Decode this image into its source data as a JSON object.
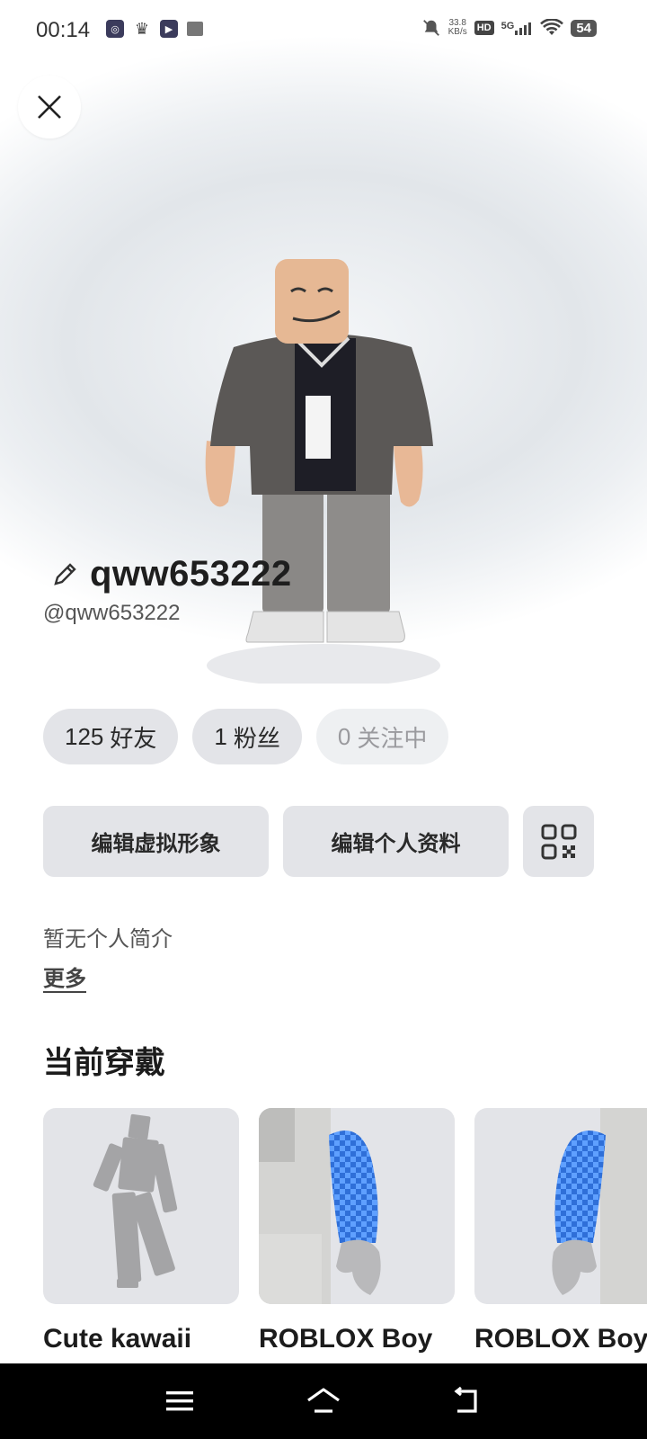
{
  "status_bar": {
    "time": "00:14",
    "net_speed_value": "33.8",
    "net_speed_unit": "KB/s",
    "hd_label": "HD",
    "signal_label": "5G",
    "battery": "54",
    "left_icons": [
      "badge-app-icon",
      "crown-icon",
      "play-app-icon",
      "book-icon"
    ]
  },
  "profile": {
    "display_name": "qww653222",
    "username": "@qww653222"
  },
  "stats": {
    "friends_count": "125",
    "friends_label": "好友",
    "followers_count": "1",
    "followers_label": "粉丝",
    "following_count": "0",
    "following_label": "关注中"
  },
  "actions": {
    "edit_avatar": "编辑虚拟形象",
    "edit_profile": "编辑个人资料"
  },
  "bio": {
    "text": "暂无个人简介",
    "more": "更多"
  },
  "wearing": {
    "title": "当前穿戴",
    "items": [
      {
        "name": "Cute kawaii"
      },
      {
        "name": "ROBLOX Boy"
      },
      {
        "name": "ROBLOX Boy"
      }
    ]
  },
  "colors": {
    "pill_bg": "#e3e4e8",
    "nav_bg": "#000000",
    "sleeve_blue": "#3a7be0"
  }
}
